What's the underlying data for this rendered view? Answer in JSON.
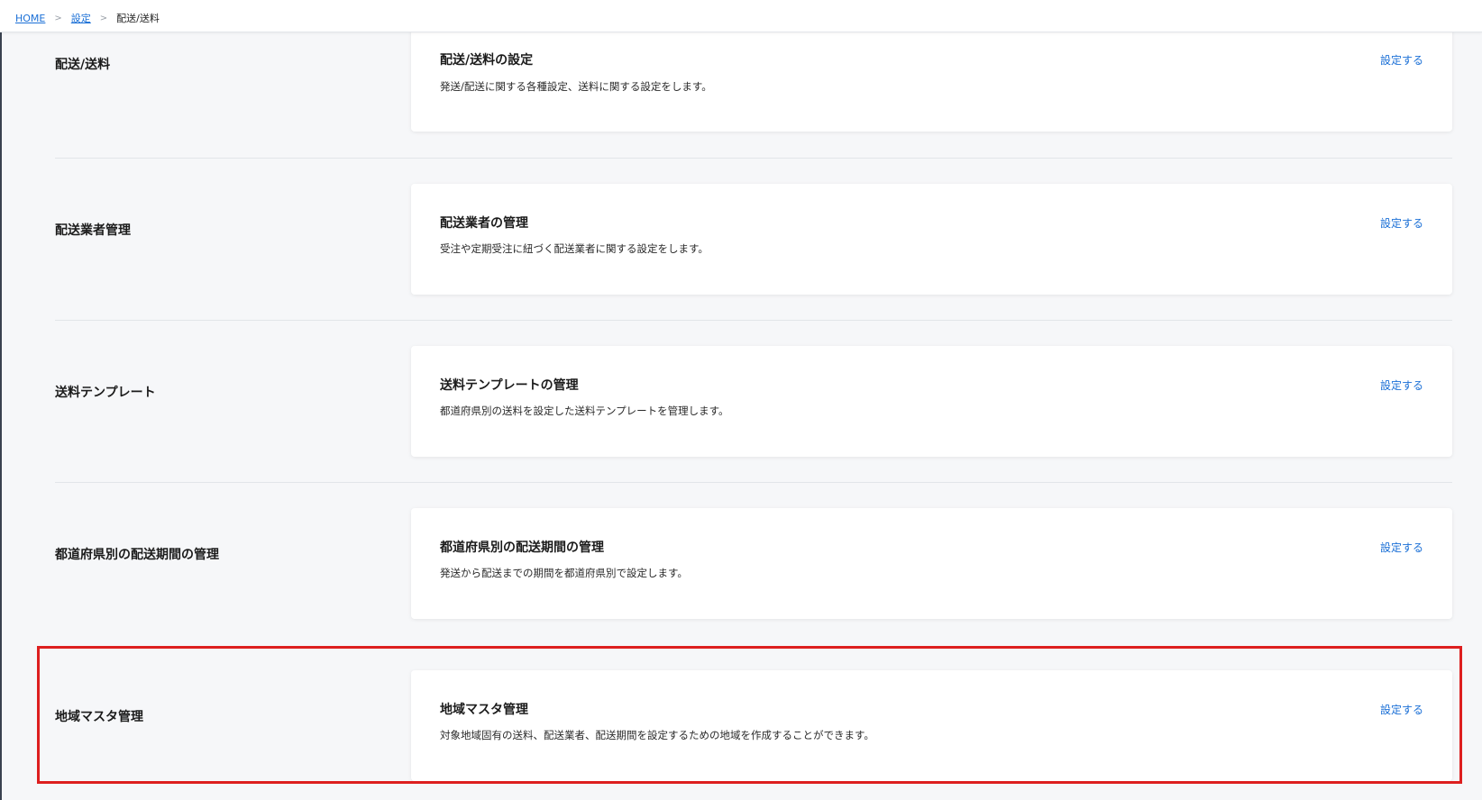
{
  "breadcrumb": {
    "home": "HOME",
    "separator": ">",
    "settings": "設定",
    "current": "配送/送料"
  },
  "sections": [
    {
      "title": "配送/送料",
      "card_title": "配送/送料の設定",
      "card_desc": "発送/配送に関する各種設定、送料に関する設定をします。",
      "link": "設定する"
    },
    {
      "title": "配送業者管理",
      "card_title": "配送業者の管理",
      "card_desc": "受注や定期受注に紐づく配送業者に関する設定をします。",
      "link": "設定する"
    },
    {
      "title": "送料テンプレート",
      "card_title": "送料テンプレートの管理",
      "card_desc": "都道府県別の送料を設定した送料テンプレートを管理します。",
      "link": "設定する"
    },
    {
      "title": "都道府県別の配送期間の管理",
      "card_title": "都道府県別の配送期間の管理",
      "card_desc": "発送から配送までの期間を都道府県別で設定します。",
      "link": "設定する"
    },
    {
      "title": "地域マスタ管理",
      "card_title": "地域マスタ管理",
      "card_desc": "対象地域固有の送料、配送業者、配送期間を設定するための地域を作成することができます。",
      "link": "設定する"
    }
  ],
  "colors": {
    "link": "#1a6fd6",
    "highlight": "#dd1f1f",
    "background": "#f6f7f9"
  }
}
